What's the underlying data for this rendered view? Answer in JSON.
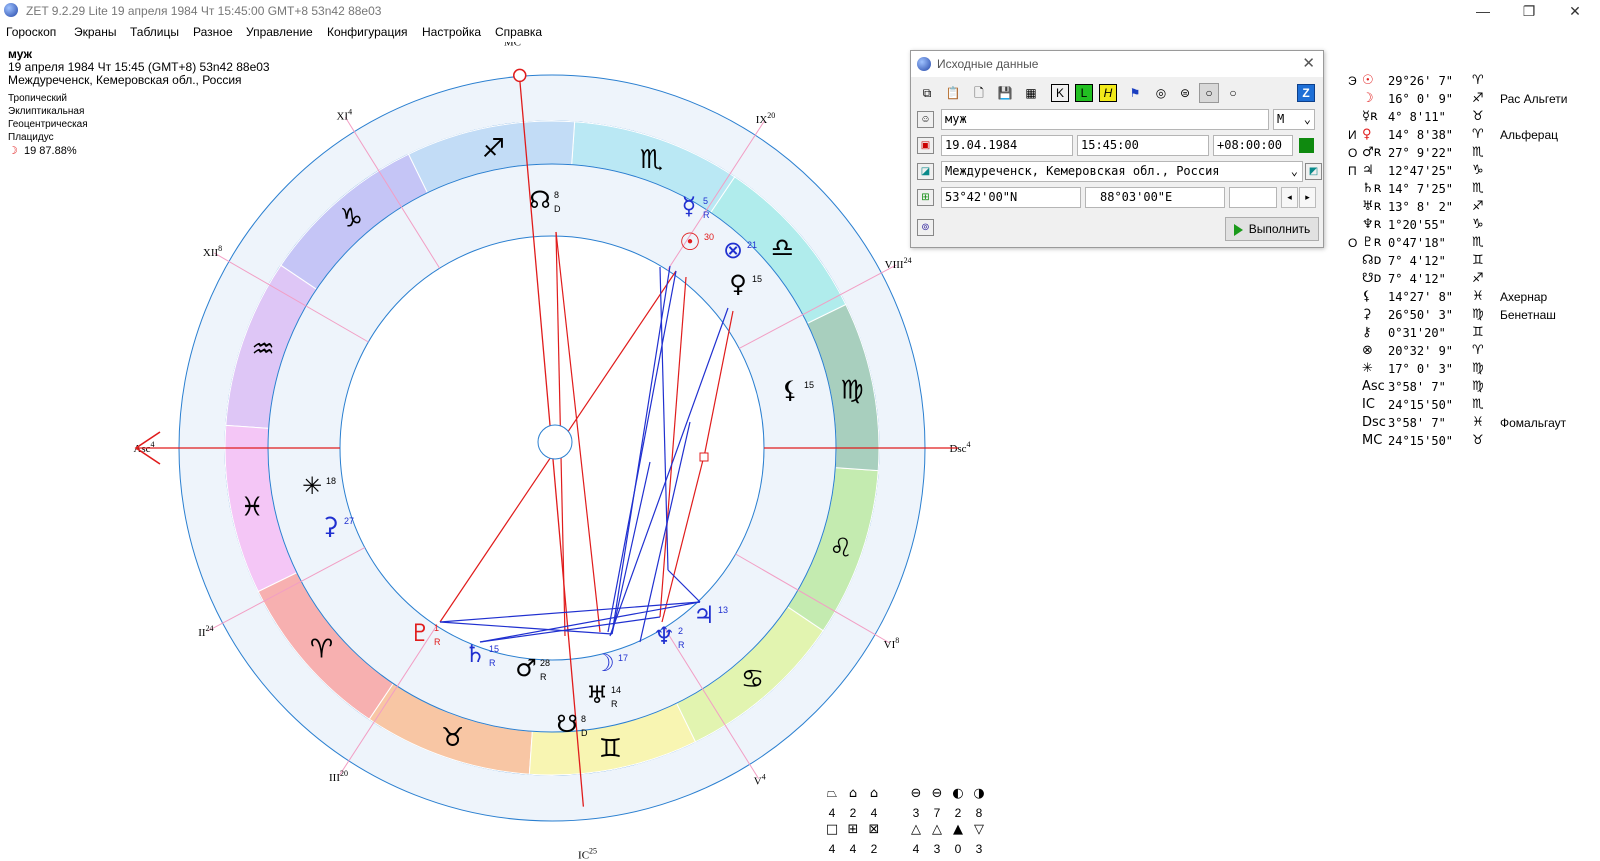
{
  "window": {
    "title": "ZET 9.2.29 Lite   19 апреля 1984  Чт  15:45:00 GMT+8 53n42  88e03"
  },
  "menu": [
    "Гороскоп",
    "Экраны",
    "Таблицы",
    "Разное",
    "Управление",
    "Конфигурация",
    "Настройка",
    "Справка"
  ],
  "info": {
    "name": "муж",
    "datetime": "19 апреля 1984  Чт  15:45 (GMT+8) 53n42  88e03",
    "place": "Междуреченск, Кемеровская обл., Россия",
    "settings": [
      "Тропический",
      "Эклиптикальная",
      "Геоцентрическая",
      "Плацидус"
    ],
    "moon_phase": "19 87.88%"
  },
  "houses": [
    {
      "label": "MC",
      "deg": "25"
    },
    {
      "label": "XI",
      "deg": "4"
    },
    {
      "label": "XII",
      "deg": "8"
    },
    {
      "label": "Asc",
      "deg": "4"
    },
    {
      "label": "II",
      "deg": "24"
    },
    {
      "label": "III",
      "deg": "20"
    },
    {
      "label": "IC",
      "deg": "25"
    },
    {
      "label": "V",
      "deg": "4"
    },
    {
      "label": "VI",
      "deg": "8"
    },
    {
      "label": "Dsc",
      "deg": "4"
    },
    {
      "label": "VIII",
      "deg": "24"
    },
    {
      "label": "IX",
      "deg": "20"
    }
  ],
  "chart_planets": [
    {
      "sym": "☉",
      "deg": "30",
      "color": "#e01c1c"
    },
    {
      "sym": "⊗",
      "deg": "21",
      "color": "#2030d0"
    },
    {
      "sym": "♀",
      "deg": "15",
      "color": "#000000"
    },
    {
      "sym": "☿",
      "deg": "5",
      "color": "#2030d0",
      "r": "R"
    },
    {
      "sym": "☊",
      "deg": "8",
      "color": "#000000",
      "r": "D"
    },
    {
      "sym": "⚸",
      "deg": "15",
      "color": "#000000"
    },
    {
      "sym": "♃",
      "deg": "13",
      "color": "#2030d0"
    },
    {
      "sym": "♆",
      "deg": "2",
      "color": "#2030d0",
      "r": "R"
    },
    {
      "sym": "☽",
      "deg": "17",
      "color": "#2030d0"
    },
    {
      "sym": "♅",
      "deg": "14",
      "color": "#000000",
      "r": "R"
    },
    {
      "sym": "☋",
      "deg": "8",
      "color": "#000000",
      "r": "D"
    },
    {
      "sym": "♂",
      "deg": "28",
      "color": "#000000",
      "r": "R"
    },
    {
      "sym": "♄",
      "deg": "15",
      "color": "#2030d0",
      "r": "R"
    },
    {
      "sym": "♇",
      "deg": "1",
      "color": "#e01c1c",
      "r": "R"
    },
    {
      "sym": "⚳",
      "deg": "27",
      "color": "#2030d0"
    },
    {
      "sym": "✳",
      "deg": "18",
      "color": "#000000"
    }
  ],
  "dialog": {
    "title": "Исходные данные",
    "name_value": "муж",
    "gender_value": "М",
    "date_value": "19.04.1984",
    "time_value": "15:45:00",
    "tz_value": "+08:00:00",
    "place_value": "Междуреченск, Кемеровская обл., Россия",
    "lat_value": "53°42'00\"N",
    "lon_value": "88°03'00\"E",
    "run_label": "Выполнить"
  },
  "planet_list": [
    {
      "code": "Э",
      "sym": "☉",
      "pos": "29°26' 7\"",
      "sign": "♈",
      "star": "",
      "color": "#e01c1c"
    },
    {
      "code": "",
      "sym": "☽",
      "pos": "16° 0' 9\"",
      "sign": "♐",
      "star": "Рас Альгети",
      "color": "#e01c1c"
    },
    {
      "code": "",
      "sym": "☿ʀ",
      "pos": "4° 8'11\"",
      "sign": "♉",
      "star": "",
      "color": "#000"
    },
    {
      "code": "И",
      "sym": "♀",
      "pos": "14° 8'38\"",
      "sign": "♈",
      "star": "Альферац",
      "color": "#e01c1c"
    },
    {
      "code": "О",
      "sym": "♂ʀ",
      "pos": "27° 9'22\"",
      "sign": "♏",
      "star": "",
      "color": "#000"
    },
    {
      "code": "П",
      "sym": "♃",
      "pos": "12°47'25\"",
      "sign": "♑",
      "star": "",
      "color": "#000"
    },
    {
      "code": "",
      "sym": "♄ʀ",
      "pos": "14° 7'25\"",
      "sign": "♏",
      "star": "",
      "color": "#000"
    },
    {
      "code": "",
      "sym": "♅ʀ",
      "pos": "13° 8' 2\"",
      "sign": "♐",
      "star": "",
      "color": "#000"
    },
    {
      "code": "",
      "sym": "♆ʀ",
      "pos": "1°20'55\"",
      "sign": "♑",
      "star": "",
      "color": "#000"
    },
    {
      "code": "О",
      "sym": "♇ʀ",
      "pos": "0°47'18\"",
      "sign": "♏",
      "star": "",
      "color": "#000"
    },
    {
      "code": "",
      "sym": "☊ᴅ",
      "pos": "7° 4'12\"",
      "sign": "♊",
      "star": "",
      "color": "#000"
    },
    {
      "code": "",
      "sym": "☋ᴅ",
      "pos": "7° 4'12\"",
      "sign": "♐",
      "star": "",
      "color": "#000"
    },
    {
      "code": "",
      "sym": "⚸",
      "pos": "14°27' 8\"",
      "sign": "♓",
      "star": "Ахернар",
      "color": "#000"
    },
    {
      "code": "",
      "sym": "⚳",
      "pos": "26°50' 3\"",
      "sign": "♍",
      "star": "Бенетнаш",
      "color": "#000"
    },
    {
      "code": "",
      "sym": "⚷",
      "pos": "0°31'20\"",
      "sign": "♊",
      "star": "",
      "color": "#000"
    },
    {
      "code": "",
      "sym": "⊗",
      "pos": "20°32' 9\"",
      "sign": "♈",
      "star": "",
      "color": "#000"
    },
    {
      "code": "",
      "sym": "✳",
      "pos": "17° 0' 3\"",
      "sign": "♍",
      "star": "",
      "color": "#000"
    },
    {
      "code": "",
      "sym": "Asc",
      "pos": "3°58' 7\"",
      "sign": "♍",
      "star": "",
      "color": "#000"
    },
    {
      "code": "",
      "sym": "IC",
      "pos": "24°15'50\"",
      "sign": "♏",
      "star": "",
      "color": "#000"
    },
    {
      "code": "",
      "sym": "Dsc",
      "pos": "3°58' 7\"",
      "sign": "♓",
      "star": "Фомальгаут",
      "color": "#000"
    },
    {
      "code": "",
      "sym": "MC",
      "pos": "24°15'50\"",
      "sign": "♉",
      "star": "",
      "color": "#000"
    }
  ],
  "stats": {
    "row1_values": [
      "4",
      "2",
      "4",
      "3",
      "7",
      "2",
      "8"
    ],
    "row2_values": [
      "4",
      "4",
      "2",
      "4",
      "3",
      "0",
      "3"
    ],
    "row1_icons": [
      "⏢",
      "⌂",
      "⌂",
      "⊖",
      "⊖",
      "◐",
      "◑"
    ],
    "row2_icons": [
      "□",
      "⊞",
      "⊠",
      "△",
      "△",
      "▲",
      "▽"
    ]
  }
}
